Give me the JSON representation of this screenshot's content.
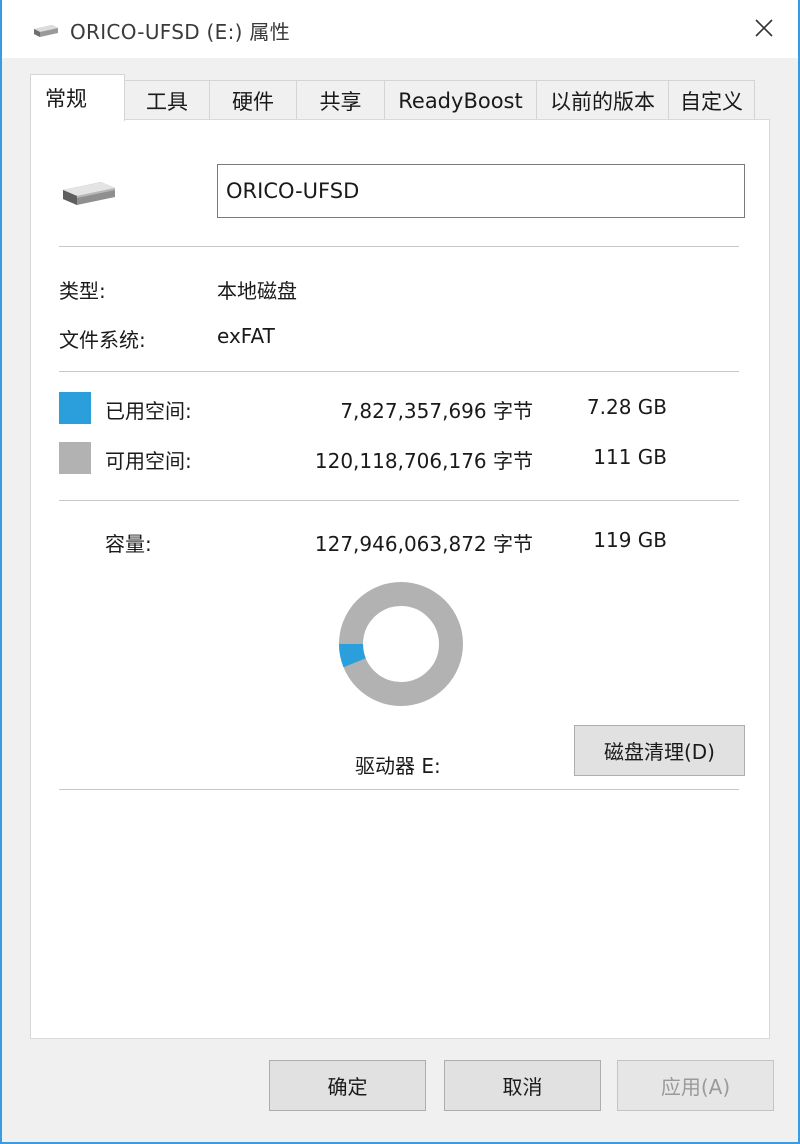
{
  "window": {
    "title": "ORICO-UFSD (E:) 属性"
  },
  "tabs": [
    {
      "label": "常规",
      "active": true
    },
    {
      "label": "工具"
    },
    {
      "label": "硬件"
    },
    {
      "label": "共享"
    },
    {
      "label": "ReadyBoost"
    },
    {
      "label": "以前的版本"
    },
    {
      "label": "自定义"
    }
  ],
  "general": {
    "drive_name": "ORICO-UFSD",
    "type_label": "类型:",
    "type_value": "本地磁盘",
    "fs_label": "文件系统:",
    "fs_value": "exFAT",
    "used": {
      "label": "已用空间:",
      "bytes": "7,827,357,696 字节",
      "size": "7.28 GB",
      "color": "#2a9fdc"
    },
    "free": {
      "label": "可用空间:",
      "bytes": "120,118,706,176 字节",
      "size": "111 GB",
      "color": "#b2b2b2"
    },
    "capacity": {
      "label": "容量:",
      "bytes": "127,946,063,872 字节",
      "size": "119 GB"
    },
    "used_fraction": 0.0612,
    "drive_label": "驱动器 E:",
    "cleanup_button": "磁盘清理(D)"
  },
  "footer": {
    "ok": "确定",
    "cancel": "取消",
    "apply": "应用(A)"
  },
  "icons": {
    "title": "usb-drive-icon",
    "close": "close-icon",
    "drive": "usb-drive-icon"
  }
}
